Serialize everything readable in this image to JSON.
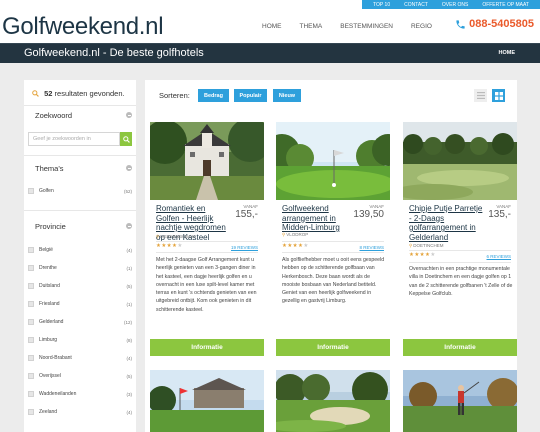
{
  "topbar": {
    "links": [
      "TOP 10",
      "CONTACT",
      "OVER ONS",
      "OFFERTE OP MAAT"
    ]
  },
  "header": {
    "logo": "Golfweekend.nl",
    "nav": [
      "HOME",
      "THEMA",
      "BESTEMMINGEN",
      "REGIO"
    ],
    "phone": "088-5405805"
  },
  "band": {
    "title": "Golfweekend.nl - De beste golfhotels",
    "breadcrumb": "HOME"
  },
  "sidebar": {
    "results_count": "52",
    "results_text": "resultaten gevonden.",
    "zoekwoord_title": "Zoekwoord",
    "search_placeholder": "Geef je zoekwoorden in",
    "themas_title": "Thema's",
    "themas": [
      {
        "label": "Golfen",
        "count": "(52)"
      }
    ],
    "provincie_title": "Provincie",
    "provincies": [
      {
        "label": "België",
        "count": "(4)"
      },
      {
        "label": "Drenthe",
        "count": "(1)"
      },
      {
        "label": "Duitsland",
        "count": "(5)"
      },
      {
        "label": "Friesland",
        "count": "(1)"
      },
      {
        "label": "Gelderland",
        "count": "(12)"
      },
      {
        "label": "Limburg",
        "count": "(8)"
      },
      {
        "label": "Noord-Brabant",
        "count": "(4)"
      },
      {
        "label": "Overijssel",
        "count": "(5)"
      },
      {
        "label": "Waddeneilanden",
        "count": "(3)"
      },
      {
        "label": "Zeeland",
        "count": "(4)"
      }
    ]
  },
  "sort": {
    "label": "Sorteren:",
    "buttons": [
      "Bedrag",
      "Populair",
      "Nieuw"
    ]
  },
  "view": {
    "list_icon": "list-view-icon",
    "grid_icon": "grid-view-icon",
    "active": "grid"
  },
  "cards": [
    {
      "title": "Romantiek en Golfen - Heerlijk nachtje wegdromen op een Kasteel",
      "vanaf": "VANAF",
      "price": "155,-",
      "location": "HERKENBOSCH",
      "stars": 4,
      "reviews": "19 REVIEWS",
      "description": "Met het 2-daagse Golf Arrangement kunt u heerlijk genieten van een 3-gangen diner in het kasteel, een dagje heerlijk golfen en u overnacht in een luxe spilt-level kamer met terras en kunt 's ochtends genieten van een uitgebreid ontbijt. Kom ook genieten in dit schitterende kasteel.",
      "button": "Informatie"
    },
    {
      "title": "Golfweekend arrangement in Midden-Limburg",
      "vanaf": "VANAF",
      "price": "139,50",
      "location": "VLODROP",
      "stars": 4,
      "reviews": "8 REVIEWS",
      "description": "Als golfliefhebber moet u ooit eens gespeeld hebben op de schitterende golfbaan van Herkenbosch. Deze baan wordt als de mooiste bosbaan van Nederland betiteld. Geniet van een heerlijk golfweekend in gezellig en gastvrij Limburg.",
      "button": "Informatie"
    },
    {
      "title": "Chipje Putje Parretje - 2-Daags golfarrangement in Gelderland",
      "vanaf": "VANAF",
      "price": "135,-",
      "location": "DOETINCHEM",
      "stars": 4,
      "reviews": "6 REVIEWS",
      "description": "Overnachten in een prachtige monumentale villa in Doetinchem en een dagje golfen op 1 van de 2 schitterende golfbanen 't Zelle of de Keppelse Golfclub.",
      "button": "Informatie"
    }
  ]
}
